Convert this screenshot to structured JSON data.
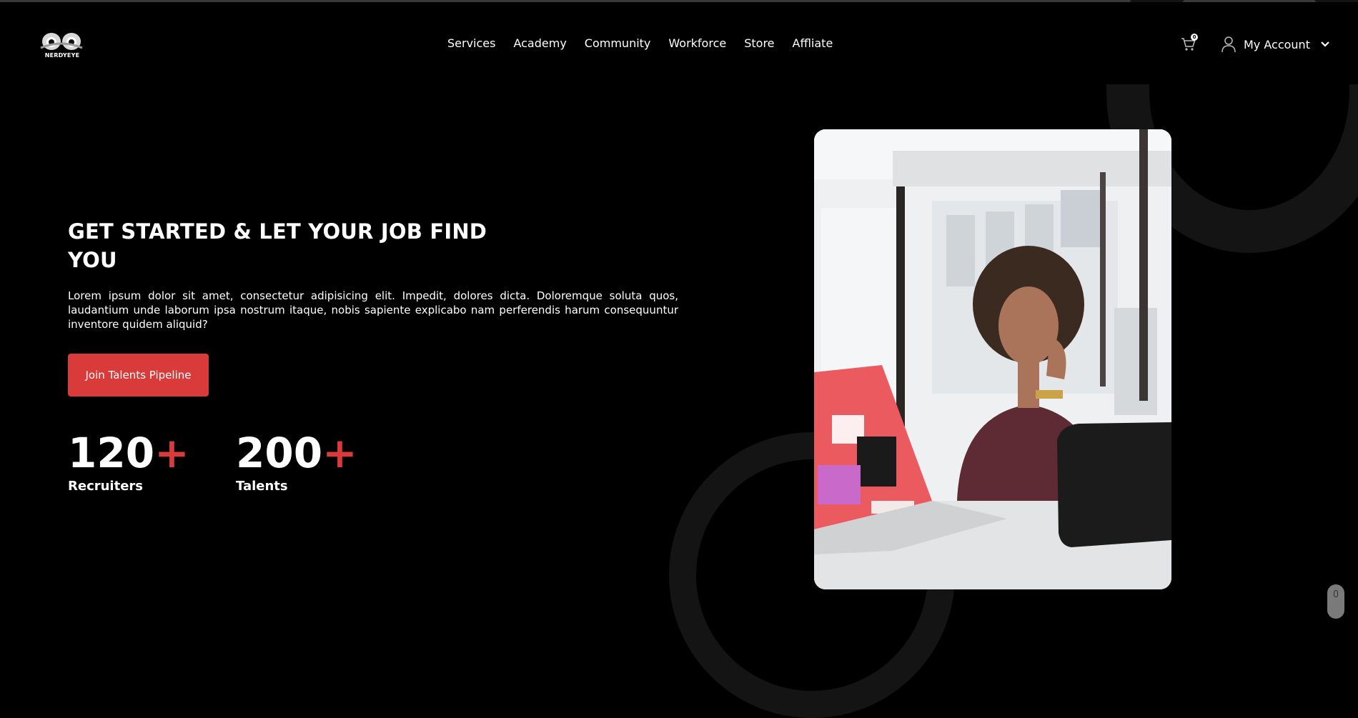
{
  "brand": {
    "name": "NERDYEYE"
  },
  "nav": {
    "items": [
      "Services",
      "Academy",
      "Community",
      "Workforce",
      "Store",
      "Affliate"
    ]
  },
  "header": {
    "cart_count": "0",
    "account_label": "My Account"
  },
  "hero": {
    "title_line1": "GET STARTED & LET YOUR JOB FIND",
    "title_line2": "YOU",
    "description": "Lorem ipsum dolor sit amet, consectetur adipisicing elit. Impedit, dolores dicta. Doloremque soluta quos, laudantium unde laborum ipsa nostrum itaque, nobis sapiente explicabo nam perferendis harum consequuntur inventore quidem aliquid?",
    "cta_label": "Join Talents Pipeline"
  },
  "stats": [
    {
      "number": "120",
      "suffix": "+",
      "label": "Recruiters"
    },
    {
      "number": "200",
      "suffix": "+",
      "label": "Talents"
    }
  ],
  "colors": {
    "accent": "#d93a3a",
    "background": "#000000",
    "ring": "#141414"
  },
  "icons": {
    "cart": "cart-icon",
    "account": "user-icon",
    "dropdown": "chevron-down-icon",
    "scroll": "mouse-scroll-icon"
  }
}
